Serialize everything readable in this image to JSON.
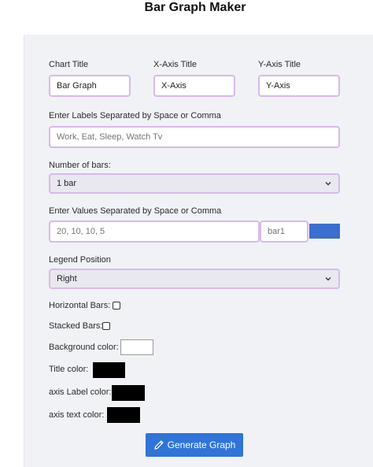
{
  "header": {
    "title": "Bar Graph Maker"
  },
  "form": {
    "chart_title": {
      "label": "Chart Title",
      "value": "Bar Graph"
    },
    "x_axis_title": {
      "label": "X-Axis Title",
      "value": "X-Axis"
    },
    "y_axis_title": {
      "label": "Y-Axis Title",
      "value": "Y-Axis"
    },
    "labels": {
      "label": "Enter Labels Separated by Space or Comma",
      "placeholder": "Work, Eat, Sleep, Watch Tv"
    },
    "num_bars": {
      "label": "Number of bars:",
      "selected": "1 bar"
    },
    "values": {
      "label": "Enter Values Separated by Space or Comma",
      "placeholder": "20, 10, 10, 5",
      "bar_name_placeholder": "bar1",
      "bar_color": "#3a6fcf"
    },
    "legend_position": {
      "label": "Legend Position",
      "selected": "Right"
    },
    "horizontal_bars": {
      "label": "Horizontal Bars:"
    },
    "stacked_bars": {
      "label": "Stacked Bars:"
    },
    "background_color": {
      "label": "Background color:",
      "color": "#ffffff"
    },
    "title_color": {
      "label": "Title color:",
      "color": "#000000"
    },
    "axis_label_color": {
      "label": "axis Label color:",
      "color": "#000000"
    },
    "axis_text_color": {
      "label": "axis text color:",
      "color": "#000000"
    },
    "generate_button": {
      "label": "Generate Graph",
      "icon": "pencil-icon"
    }
  },
  "colors": {
    "accent": "#2f74d8",
    "input_border": "#d9b8ec",
    "panel_background": "#f1f2f6"
  }
}
